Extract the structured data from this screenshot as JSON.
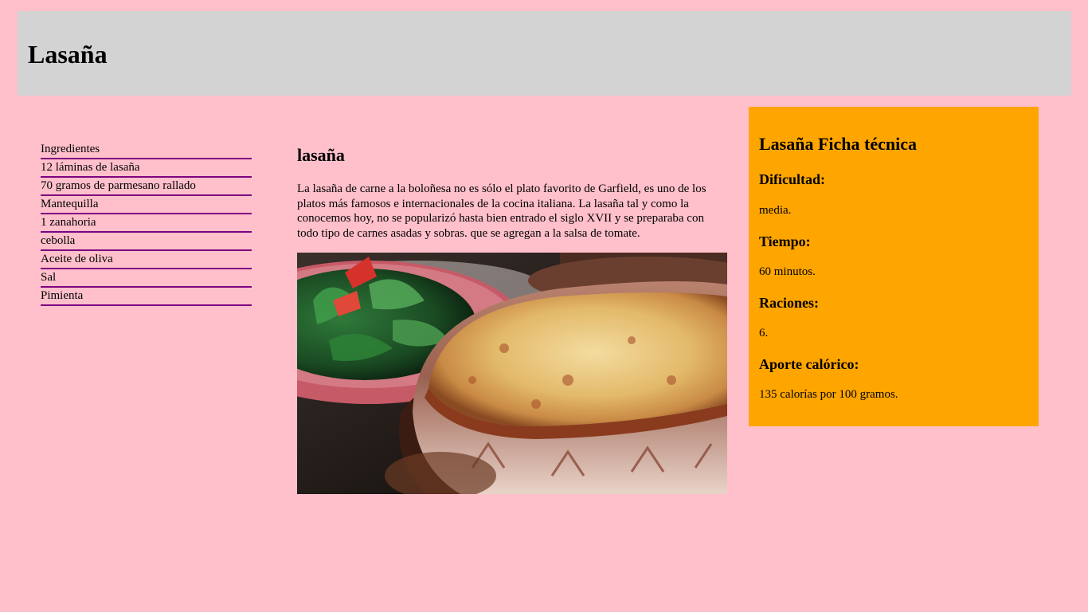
{
  "header": {
    "title": "Lasaña"
  },
  "ingredients": {
    "items": [
      "Ingredientes",
      "12 láminas de lasaña",
      "70 gramos de parmesano rallado",
      "Mantequilla",
      "1 zanahoria",
      "cebolla",
      "Aceite de oliva",
      "Sal",
      "Pimienta"
    ]
  },
  "article": {
    "title": "lasaña",
    "paragraph": "La lasaña de carne a la boloñesa no es sólo el plato favorito de Garfield, es uno de los platos más famosos e internacionales de la cocina italiana. La lasaña tal y como la conocemos hoy, no se popularizó hasta bien entrado el siglo XVII y se preparaba con todo tipo de carnes asadas y sobras. que se agregan a la salsa de tomate."
  },
  "ficha": {
    "title": "Lasaña Ficha técnica",
    "dificultad_label": "Dificultad:",
    "dificultad_value": "media.",
    "tiempo_label": "Tiempo:",
    "tiempo_value": "60 minutos.",
    "raciones_label": "Raciones:",
    "raciones_value": "6.",
    "aporte_label": "Aporte calórico:",
    "aporte_value": "135 calorías por 100 gramos."
  },
  "colors": {
    "page_background": "#ffc0cb",
    "header_background": "#d3d3d3",
    "sidebar_underline": "#800080",
    "ficha_background": "#ffa500"
  }
}
